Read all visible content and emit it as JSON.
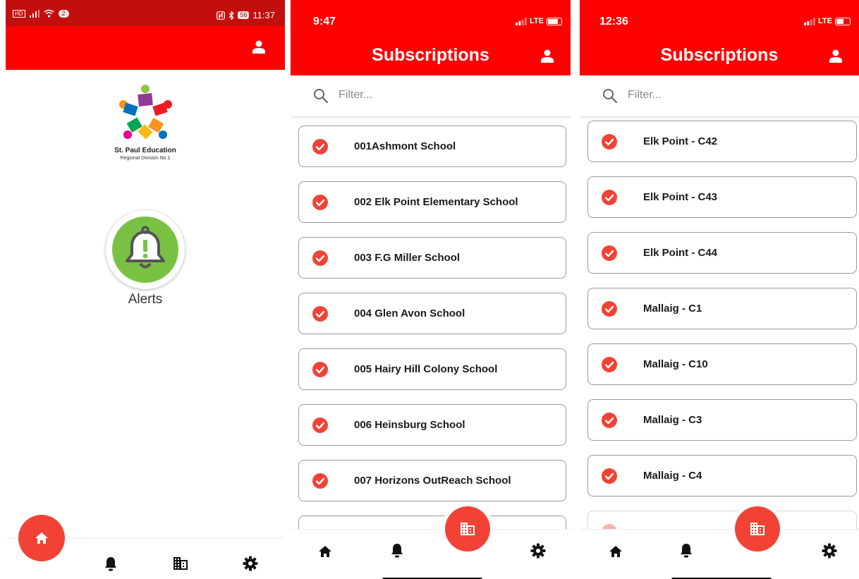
{
  "colors": {
    "app_bar": "#ff0000",
    "android_status_bar": "#c40e0e",
    "fab": "#f24236",
    "check": "#f24236",
    "alerts_green": "#79c143"
  },
  "home_screen": {
    "status_bar": {
      "left_icons": [
        "hd-icon",
        "signal-icon",
        "wifi-icon"
      ],
      "notification_count": "2",
      "right_icons": [
        "nfc-icon",
        "bluetooth-icon"
      ],
      "battery_level": "56",
      "time": "11:37"
    },
    "logo": {
      "title": "St. Paul Education",
      "subtitle": "Regional Division No.1"
    },
    "alerts_label": "Alerts",
    "nav": [
      "home-icon",
      "bell-icon",
      "building-icon",
      "gear-icon"
    ],
    "active_nav": "home"
  },
  "subscriptions_a": {
    "status_time": "9:47",
    "network": "LTE",
    "title": "Subscriptions",
    "filter_placeholder": "Filter...",
    "items": [
      "001Ashmont School",
      "002 Elk Point Elementary School",
      "003 F.G Miller School",
      "004 Glen Avon School",
      "005 Hairy Hill Colony School",
      "006 Heinsburg School",
      "007 Horizons OutReach School"
    ],
    "nav": [
      "home-icon",
      "bell-icon",
      "building-icon",
      "gear-icon"
    ],
    "active_nav": "building"
  },
  "subscriptions_b": {
    "status_time": "12:36",
    "network": "LTE",
    "title": "Subscriptions",
    "filter_placeholder": "Filter...",
    "items": [
      "Elk Point - C42",
      "Elk Point - C43",
      "Elk Point - C44",
      "Mallaig - C1",
      "Mallaig - C10",
      "Mallaig - C3",
      "Mallaig - C4"
    ],
    "nav": [
      "home-icon",
      "bell-icon",
      "building-icon",
      "gear-icon"
    ],
    "active_nav": "building"
  }
}
